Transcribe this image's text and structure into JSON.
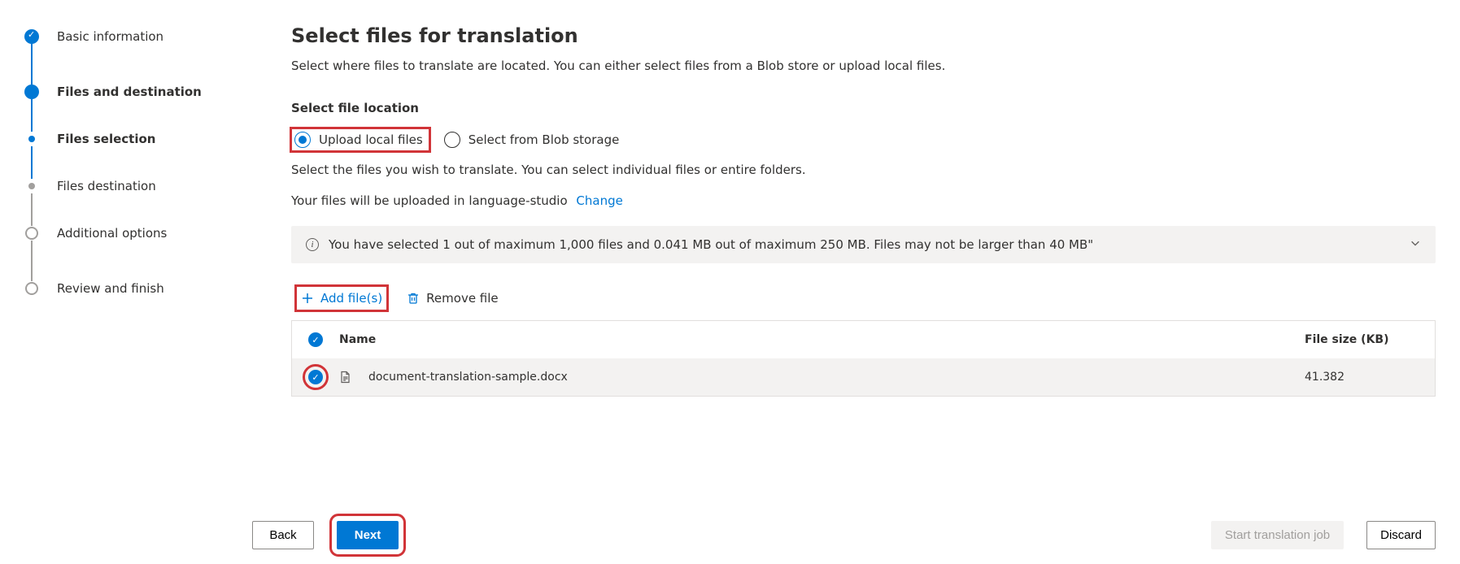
{
  "stepper": {
    "steps": [
      {
        "label": "Basic information"
      },
      {
        "label": "Files and destination"
      },
      {
        "label": "Files selection"
      },
      {
        "label": "Files destination"
      },
      {
        "label": "Additional options"
      },
      {
        "label": "Review and finish"
      }
    ]
  },
  "main": {
    "title": "Select files for translation",
    "description": "Select where files to translate are located. You can either select files from a Blob store or upload local files.",
    "location_label": "Select file location",
    "radio": {
      "upload": "Upload local files",
      "blob": "Select from Blob storage"
    },
    "hint": "Select the files you wish to translate. You can select individual files or entire folders.",
    "upload_dest_prefix": "Your files will be uploaded in language-studio",
    "change_link": "Change",
    "info_text": "You have selected 1 out of maximum 1,000 files and 0.041 MB out of maximum 250 MB. Files may not be larger than 40 MB\"",
    "toolbar": {
      "add": "Add file(s)",
      "remove": "Remove file"
    },
    "table": {
      "col_name": "Name",
      "col_size": "File size (KB)",
      "rows": [
        {
          "name": "document-translation-sample.docx",
          "size": "41.382"
        }
      ]
    }
  },
  "footer": {
    "back": "Back",
    "next": "Next",
    "start": "Start translation job",
    "discard": "Discard"
  }
}
